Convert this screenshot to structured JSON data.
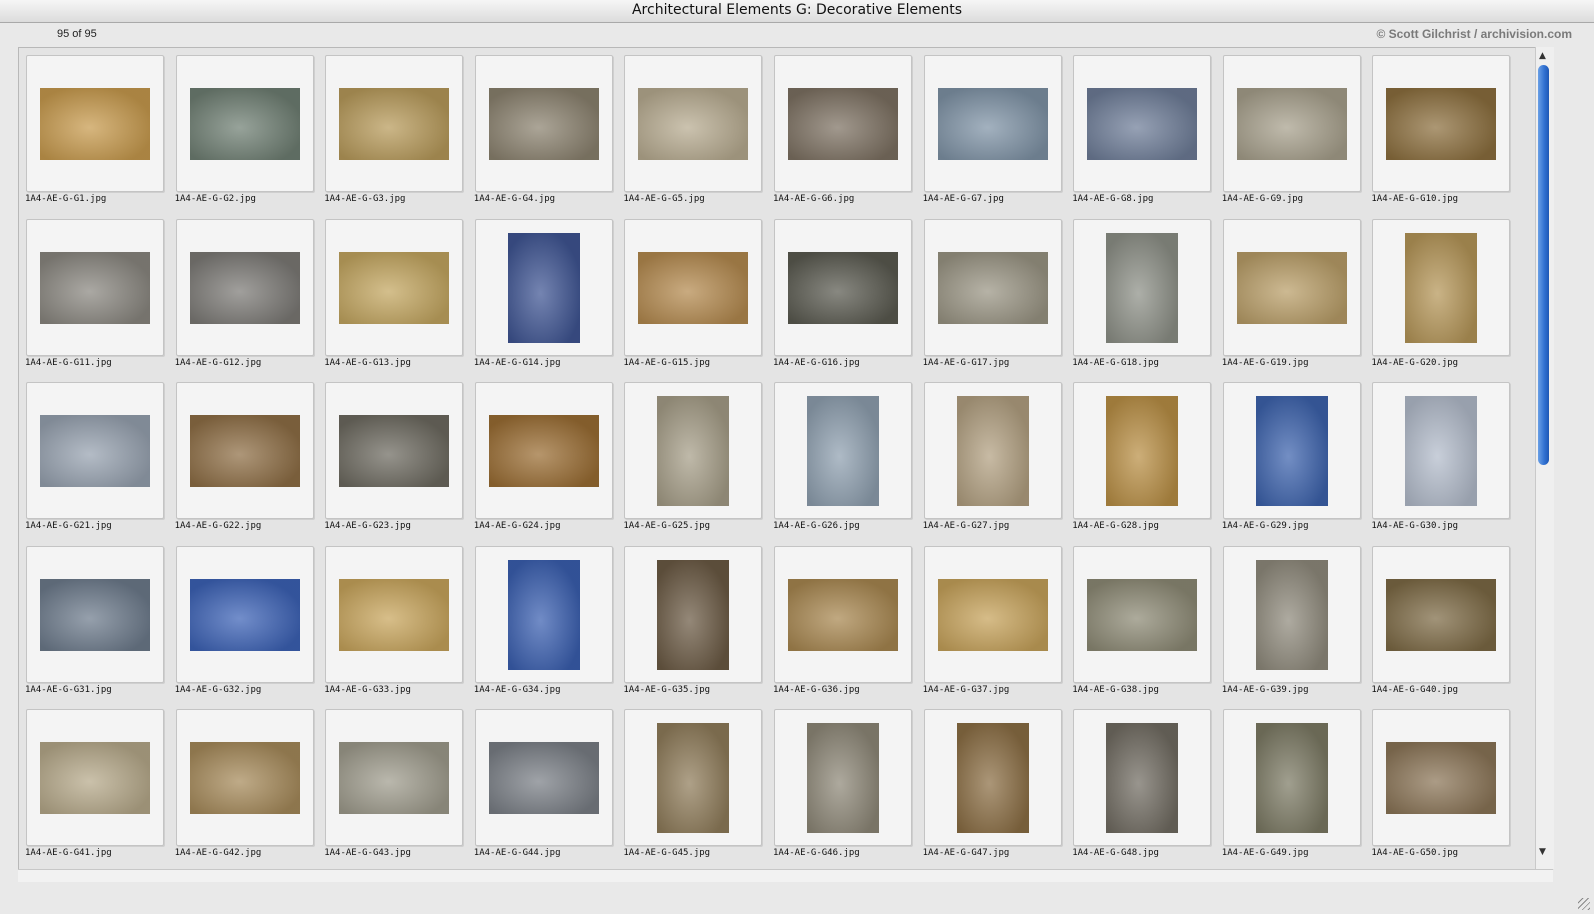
{
  "window": {
    "title": "Architectural Elements G: Decorative Elements"
  },
  "header": {
    "count": "95 of 95",
    "credit": "© Scott Gilchrist / archivision.com"
  },
  "thumbnails": [
    {
      "file": "1A4-AE-G-G1.jpg",
      "orientation": "landscape",
      "color": "#c79a4d"
    },
    {
      "file": "1A4-AE-G-G2.jpg",
      "orientation": "landscape",
      "color": "#6f7f73"
    },
    {
      "file": "1A4-AE-G-G3.jpg",
      "orientation": "landscape",
      "color": "#b79a5a"
    },
    {
      "file": "1A4-AE-G-G4.jpg",
      "orientation": "landscape",
      "color": "#8b826f"
    },
    {
      "file": "1A4-AE-G-G5.jpg",
      "orientation": "landscape",
      "color": "#b7ab90"
    },
    {
      "file": "1A4-AE-G-G6.jpg",
      "orientation": "landscape",
      "color": "#7d7162"
    },
    {
      "file": "1A4-AE-G-G7.jpg",
      "orientation": "landscape",
      "color": "#7f93a6"
    },
    {
      "file": "1A4-AE-G-G8.jpg",
      "orientation": "landscape",
      "color": "#6e7d98"
    },
    {
      "file": "1A4-AE-G-G9.jpg",
      "orientation": "landscape",
      "color": "#a7a08c"
    },
    {
      "file": "1A4-AE-G-G10.jpg",
      "orientation": "landscape",
      "color": "#8c6f3e"
    },
    {
      "file": "1A4-AE-G-G11.jpg",
      "orientation": "landscape",
      "color": "#8a8780"
    },
    {
      "file": "1A4-AE-G-G12.jpg",
      "orientation": "landscape",
      "color": "#7c7a76"
    },
    {
      "file": "1A4-AE-G-G13.jpg",
      "orientation": "landscape",
      "color": "#c3a660"
    },
    {
      "file": "1A4-AE-G-G14.jpg",
      "orientation": "portrait",
      "color": "#3f5593"
    },
    {
      "file": "1A4-AE-G-G15.jpg",
      "orientation": "landscape",
      "color": "#b48a4f"
    },
    {
      "file": "1A4-AE-G-G16.jpg",
      "orientation": "landscape",
      "color": "#5a5a50"
    },
    {
      "file": "1A4-AE-G-G17.jpg",
      "orientation": "landscape",
      "color": "#9a9584"
    },
    {
      "file": "1A4-AE-G-G18.jpg",
      "orientation": "portrait",
      "color": "#8d9087"
    },
    {
      "file": "1A4-AE-G-G19.jpg",
      "orientation": "landscape",
      "color": "#b99e68"
    },
    {
      "file": "1A4-AE-G-G20.jpg",
      "orientation": "portrait",
      "color": "#b59658"
    },
    {
      "file": "1A4-AE-G-G21.jpg",
      "orientation": "landscape",
      "color": "#97a2b0"
    },
    {
      "file": "1A4-AE-G-G22.jpg",
      "orientation": "landscape",
      "color": "#8e6e45"
    },
    {
      "file": "1A4-AE-G-G23.jpg",
      "orientation": "landscape",
      "color": "#6d6a60"
    },
    {
      "file": "1A4-AE-G-G24.jpg",
      "orientation": "landscape",
      "color": "#9a6d33"
    },
    {
      "file": "1A4-AE-G-G25.jpg",
      "orientation": "portrait",
      "color": "#a69e88"
    },
    {
      "file": "1A4-AE-G-G26.jpg",
      "orientation": "portrait",
      "color": "#8fa0b0"
    },
    {
      "file": "1A4-AE-G-G27.jpg",
      "orientation": "portrait",
      "color": "#b2a081"
    },
    {
      "file": "1A4-AE-G-G28.jpg",
      "orientation": "portrait",
      "color": "#b98f45"
    },
    {
      "file": "1A4-AE-G-G29.jpg",
      "orientation": "portrait",
      "color": "#3d63ad"
    },
    {
      "file": "1A4-AE-G-G30.jpg",
      "orientation": "portrait",
      "color": "#b3bccb"
    },
    {
      "file": "1A4-AE-G-G31.jpg",
      "orientation": "landscape",
      "color": "#6d7b8c"
    },
    {
      "file": "1A4-AE-G-G32.jpg",
      "orientation": "landscape",
      "color": "#3c62b6"
    },
    {
      "file": "1A4-AE-G-G33.jpg",
      "orientation": "landscape",
      "color": "#c8a55c"
    },
    {
      "file": "1A4-AE-G-G34.jpg",
      "orientation": "portrait",
      "color": "#3a5fb0"
    },
    {
      "file": "1A4-AE-G-G35.jpg",
      "orientation": "portrait",
      "color": "#6b5a44"
    },
    {
      "file": "1A4-AE-G-G36.jpg",
      "orientation": "landscape",
      "color": "#a88750"
    },
    {
      "file": "1A4-AE-G-G37.jpg",
      "orientation": "landscape",
      "color": "#c6a25a"
    },
    {
      "file": "1A4-AE-G-G38.jpg",
      "orientation": "landscape",
      "color": "#8d8a75"
    },
    {
      "file": "1A4-AE-G-G39.jpg",
      "orientation": "portrait",
      "color": "#8f8a7c"
    },
    {
      "file": "1A4-AE-G-G40.jpg",
      "orientation": "landscape",
      "color": "#7d6a45"
    },
    {
      "file": "1A4-AE-G-G41.jpg",
      "orientation": "landscape",
      "color": "#b6a98a"
    },
    {
      "file": "1A4-AE-G-G42.jpg",
      "orientation": "landscape",
      "color": "#a68a5a"
    },
    {
      "file": "1A4-AE-G-G43.jpg",
      "orientation": "landscape",
      "color": "#9f9c8d"
    },
    {
      "file": "1A4-AE-G-G44.jpg",
      "orientation": "landscape",
      "color": "#7a7f86"
    },
    {
      "file": "1A4-AE-G-G45.jpg",
      "orientation": "portrait",
      "color": "#8f7c5a"
    },
    {
      "file": "1A4-AE-G-G46.jpg",
      "orientation": "portrait",
      "color": "#8e8878"
    },
    {
      "file": "1A4-AE-G-G47.jpg",
      "orientation": "portrait",
      "color": "#8b6e44"
    },
    {
      "file": "1A4-AE-G-G48.jpg",
      "orientation": "portrait",
      "color": "#716c62"
    },
    {
      "file": "1A4-AE-G-G49.jpg",
      "orientation": "portrait",
      "color": "#7c7a64"
    },
    {
      "file": "1A4-AE-G-G50.jpg",
      "orientation": "landscape",
      "color": "#8b7557"
    }
  ],
  "scroll": {
    "up_icon": "▲",
    "down_icon": "▼"
  }
}
